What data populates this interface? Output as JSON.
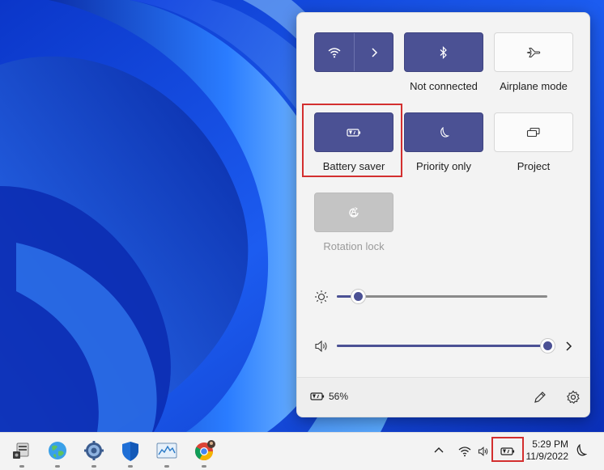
{
  "quick_settings": {
    "tiles": [
      {
        "id": "wifi",
        "label": "",
        "state": "on",
        "icon": "wifi-icon",
        "more_icon": "chevron-right-icon"
      },
      {
        "id": "bluetooth",
        "label": "Not connected",
        "state": "on",
        "icon": "bluetooth-icon"
      },
      {
        "id": "airplane",
        "label": "Airplane mode",
        "state": "off",
        "icon": "airplane-icon"
      },
      {
        "id": "battery_saver",
        "label": "Battery saver",
        "state": "on",
        "icon": "battery-saver-icon",
        "highlighted": true
      },
      {
        "id": "focus",
        "label": "Priority only",
        "state": "on",
        "icon": "moon-icon"
      },
      {
        "id": "project",
        "label": "Project",
        "state": "off",
        "icon": "project-icon"
      },
      {
        "id": "rotation_lock",
        "label": "Rotation lock",
        "state": "disabled",
        "icon": "rotation-lock-icon"
      }
    ],
    "brightness": {
      "icon": "sun-icon",
      "level": 0.1
    },
    "volume": {
      "icon": "speaker-icon",
      "level": 1.0,
      "more_icon": "chevron-right-icon"
    },
    "footer": {
      "battery_icon": "battery-charging-icon",
      "battery_percent": "56%",
      "edit_icon": "pencil-icon",
      "settings_icon": "gear-icon"
    },
    "accent_color": "#4b5194"
  },
  "taskbar": {
    "apps": [
      {
        "name": "device-manager-icon"
      },
      {
        "name": "network-globe-icon"
      },
      {
        "name": "settings-gear-icon"
      },
      {
        "name": "windows-security-icon"
      },
      {
        "name": "resource-monitor-icon"
      },
      {
        "name": "chrome-icon"
      }
    ],
    "tray": {
      "chevron_icon": "chevron-up-icon",
      "wifi_icon": "wifi-icon",
      "volume_icon": "speaker-icon",
      "battery_icon": "battery-charging-icon",
      "time": "5:29 PM",
      "date": "11/9/2022",
      "focus_icon": "moon-icon"
    }
  },
  "highlight_color": "#d32f2f"
}
